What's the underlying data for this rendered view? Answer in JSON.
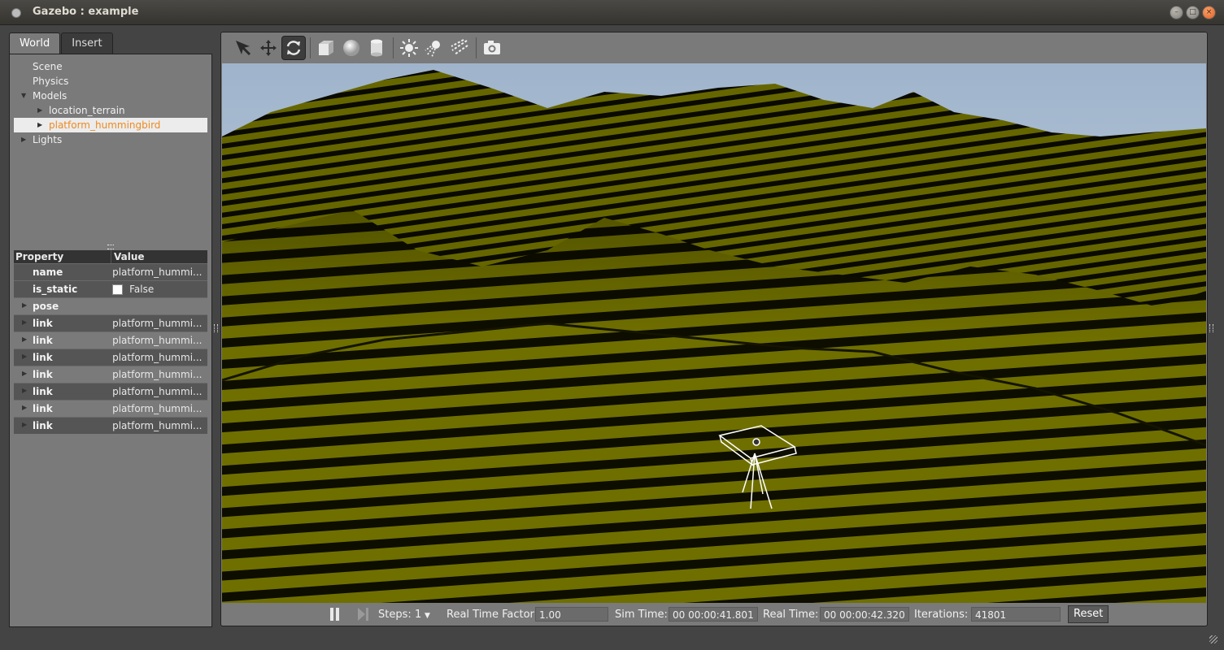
{
  "window": {
    "title": "Gazebo : example"
  },
  "tabs": [
    {
      "label": "World"
    },
    {
      "label": "Insert"
    }
  ],
  "tree": {
    "items": [
      {
        "label": "Scene"
      },
      {
        "label": "Physics"
      },
      {
        "label": "Models"
      },
      {
        "label": "location_terrain"
      },
      {
        "label": "platform_hummingbird"
      },
      {
        "label": "Lights"
      }
    ]
  },
  "props": {
    "header": {
      "property": "Property",
      "value": "Value"
    },
    "rows": [
      {
        "name": "name",
        "value": "platform_hummi..."
      },
      {
        "name": "is_static",
        "value": "False"
      },
      {
        "name": "pose",
        "value": ""
      },
      {
        "name": "link",
        "value": "platform_hummi..."
      },
      {
        "name": "link",
        "value": "platform_hummi..."
      },
      {
        "name": "link",
        "value": "platform_hummi..."
      },
      {
        "name": "link",
        "value": "platform_hummi..."
      },
      {
        "name": "link",
        "value": "platform_hummi..."
      },
      {
        "name": "link",
        "value": "platform_hummi..."
      },
      {
        "name": "link",
        "value": "platform_hummi..."
      }
    ]
  },
  "toolbar": {
    "icons": [
      "select-arrow-icon",
      "translate-icon",
      "rotate-icon",
      "box-icon",
      "sphere-icon",
      "cylinder-icon",
      "point-light-icon",
      "spot-light-icon",
      "directional-light-icon",
      "screenshot-camera-icon"
    ],
    "active": "rotate-icon"
  },
  "bottom": {
    "steps_label": "Steps:",
    "steps_value": "1",
    "rtf_label": "Real Time Factor:",
    "rtf_value": "1.00",
    "sim_label": "Sim Time:",
    "sim_value": "00 00:00:41.801",
    "real_label": "Real Time:",
    "real_value": "00 00:00:42.320",
    "iter_label": "Iterations:",
    "iter_value": "41801",
    "reset_label": "Reset"
  },
  "colors": {
    "terrain": "#6f6f00",
    "stripe": "#000000",
    "sky": "#b9c6d6",
    "selected_text": "#ee8a20"
  }
}
